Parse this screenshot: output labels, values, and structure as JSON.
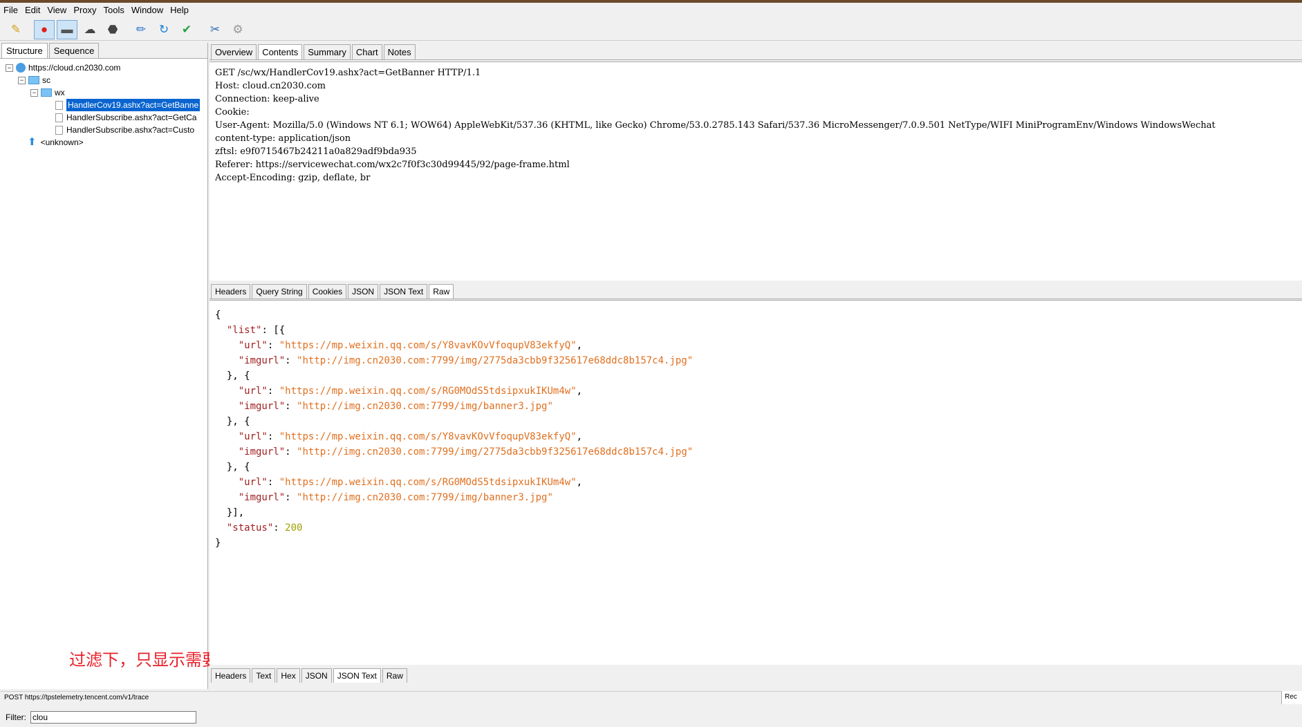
{
  "menu": [
    "File",
    "Edit",
    "View",
    "Proxy",
    "Tools",
    "Window",
    "Help"
  ],
  "left_tabs": {
    "structure": "Structure",
    "sequence": "Sequence"
  },
  "tree": {
    "host": "https://cloud.cn2030.com",
    "folder_sc": "sc",
    "folder_wx": "wx",
    "items": [
      "HandlerCov19.ashx?act=GetBanne",
      "HandlerSubscribe.ashx?act=GetCa",
      "HandlerSubscribe.ashx?act=Custo"
    ],
    "unknown": "<unknown>"
  },
  "filter": {
    "label": "Filter:",
    "value": "clou"
  },
  "annotation": "过滤下，只显示需要查看的域名",
  "right_tabs": [
    "Overview",
    "Contents",
    "Summary",
    "Chart",
    "Notes"
  ],
  "request_lines": [
    "GET /sc/wx/HandlerCov19.ashx?act=GetBanner HTTP/1.1",
    "Host: cloud.cn2030.com",
    "Connection: keep-alive",
    "Cookie:",
    "User-Agent: Mozilla/5.0 (Windows NT 6.1; WOW64) AppleWebKit/537.36 (KHTML, like Gecko) Chrome/53.0.2785.143 Safari/537.36 MicroMessenger/7.0.9.501 NetType/WIFI MiniProgramEnv/Windows WindowsWechat",
    "content-type: application/json",
    "zftsl: e9f0715467b24211a0a829adf9bda935",
    "Referer: https://servicewechat.com/wx2c7f0f3c30d99445/92/page-frame.html",
    "Accept-Encoding: gzip, deflate, br"
  ],
  "request_tabs": [
    "Headers",
    "Query String",
    "Cookies",
    "JSON",
    "JSON Text",
    "Raw"
  ],
  "response": {
    "list": [
      {
        "url": "https://mp.weixin.qq.com/s/Y8vavKOvVfoqupV83ekfyQ",
        "imgurl": "http://img.cn2030.com:7799/img/2775da3cbb9f325617e68ddc8b157c4.jpg"
      },
      {
        "url": "https://mp.weixin.qq.com/s/RG0MOdS5tdsipxukIKUm4w",
        "imgurl": "http://img.cn2030.com:7799/img/banner3.jpg"
      },
      {
        "url": "https://mp.weixin.qq.com/s/Y8vavKOvVfoqupV83ekfyQ",
        "imgurl": "http://img.cn2030.com:7799/img/2775da3cbb9f325617e68ddc8b157c4.jpg"
      },
      {
        "url": "https://mp.weixin.qq.com/s/RG0MOdS5tdsipxukIKUm4w",
        "imgurl": "http://img.cn2030.com:7799/img/banner3.jpg"
      }
    ],
    "status": "200"
  },
  "response_tabs": [
    "Headers",
    "Text",
    "Hex",
    "JSON",
    "JSON Text",
    "Raw"
  ],
  "status_text": "POST https://tpstelemetry.tencent.com/v1/trace",
  "status_right": "Rec",
  "icons": [
    "broom-icon",
    "record-icon",
    "throttle-icon",
    "turtle-icon",
    "stop-icon",
    "pen-icon",
    "refresh-icon",
    "check-icon",
    "tools-icon",
    "gear-icon"
  ]
}
